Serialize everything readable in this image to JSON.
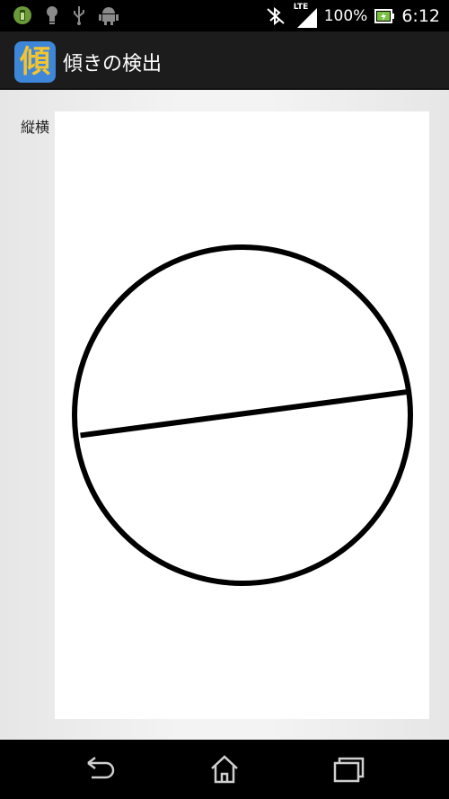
{
  "status_bar": {
    "network": "LTE",
    "battery_percent": "100%",
    "time": "6:12",
    "icons": [
      "battery-saver-icon",
      "bulb-icon",
      "usb-icon",
      "android-debug-icon",
      "bluetooth-off-icon",
      "signal-icon",
      "battery-charging-icon"
    ]
  },
  "app": {
    "icon_char": "傾",
    "title": "傾きの検出"
  },
  "main": {
    "orientation_label": "縦横",
    "tilt": {
      "line_left_point": [
        -0.965,
        -0.12
      ],
      "line_right_point": [
        0.99,
        0.14
      ]
    }
  },
  "nav": {
    "buttons": [
      "back-icon",
      "home-icon",
      "recents-icon"
    ]
  }
}
